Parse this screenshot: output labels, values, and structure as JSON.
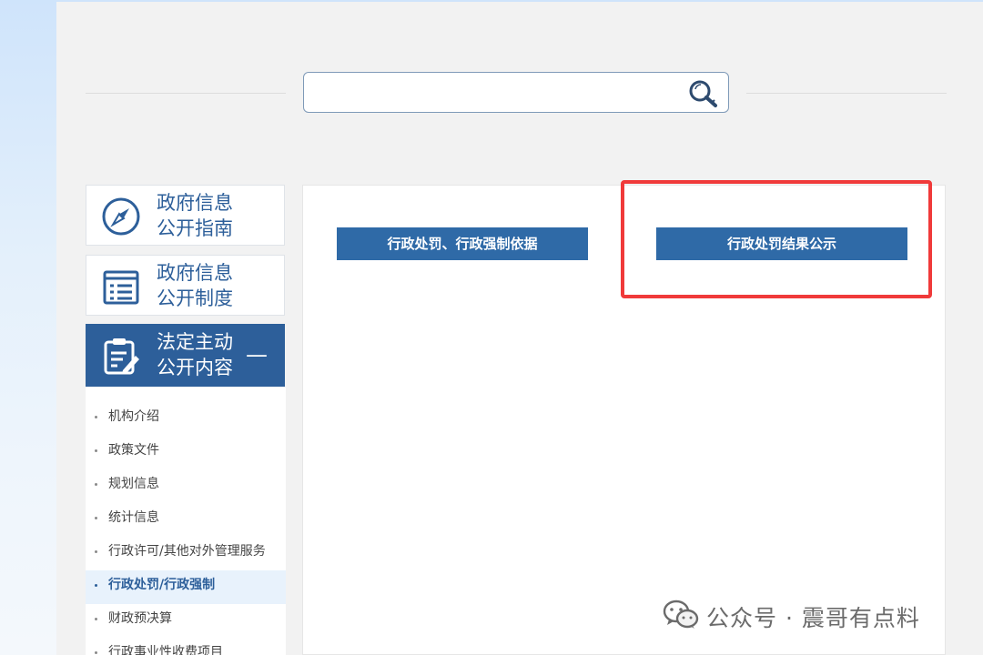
{
  "search": {
    "placeholder": "",
    "value": ""
  },
  "sidebar": {
    "cards": [
      {
        "line1": "政府信息",
        "line2": "公开指南",
        "icon": "compass-icon"
      },
      {
        "line1": "政府信息",
        "line2": "公开制度",
        "icon": "list-document-icon"
      },
      {
        "line1": "法定主动",
        "line2": "公开内容",
        "icon": "clipboard-edit-icon",
        "active": true,
        "toggle": "—"
      }
    ],
    "subnav": [
      "机构介绍",
      "政策文件",
      "规划信息",
      "统计信息",
      "行政许可/其他对外管理服务",
      "行政处罚/行政强制",
      "财政预决算",
      "行政事业性收费项目"
    ],
    "subnav_active_index": 5
  },
  "content": {
    "buttons": [
      {
        "label": "行政处罚、行政强制依据"
      },
      {
        "label": "行政处罚结果公示"
      }
    ]
  },
  "watermark": {
    "text": "公众号 · 震哥有点料",
    "icon": "wechat-icon"
  },
  "colors": {
    "primary": "#2f6aa7",
    "highlight": "#f03a3a",
    "panel": "#f2f2f2"
  }
}
